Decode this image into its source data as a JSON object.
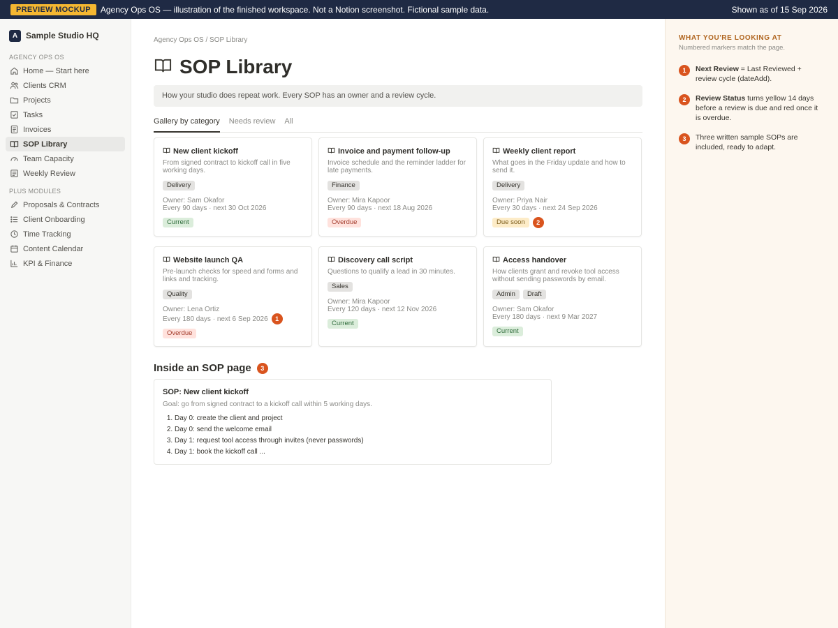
{
  "banner": {
    "badge": "PREVIEW MOCKUP",
    "message": "Agency Ops OS — illustration of the finished workspace. Not a Notion screenshot. Fictional sample data.",
    "as_of": "Shown as of 15 Sep 2026"
  },
  "workspace": {
    "logo_letter": "A",
    "name": "Sample Studio HQ"
  },
  "sidebar": {
    "section1": "AGENCY OPS OS",
    "items": [
      {
        "label": "Home — Start here",
        "icon": "home-icon"
      },
      {
        "label": "Clients CRM",
        "icon": "users-icon"
      },
      {
        "label": "Projects",
        "icon": "folder-icon"
      },
      {
        "label": "Tasks",
        "icon": "checkbox-icon"
      },
      {
        "label": "Invoices",
        "icon": "invoice-icon"
      },
      {
        "label": "SOP Library",
        "icon": "book-icon",
        "active": true
      },
      {
        "label": "Team Capacity",
        "icon": "gauge-icon"
      },
      {
        "label": "Weekly Review",
        "icon": "review-icon"
      }
    ],
    "section2": "PLUS MODULES",
    "items2": [
      {
        "label": "Proposals & Contracts",
        "icon": "pen-icon"
      },
      {
        "label": "Client Onboarding",
        "icon": "list-icon"
      },
      {
        "label": "Time Tracking",
        "icon": "clock-icon"
      },
      {
        "label": "Content Calendar",
        "icon": "calendar-icon"
      },
      {
        "label": "KPI & Finance",
        "icon": "chart-icon"
      }
    ]
  },
  "main": {
    "breadcrumb": "Agency Ops OS / SOP Library",
    "title": "SOP Library",
    "callout": "How your studio does repeat work. Every SOP has an owner and a review cycle.",
    "tabs": [
      "Gallery by category",
      "Needs review",
      "All"
    ],
    "cards": [
      {
        "title": "New client kickoff",
        "desc": "From signed contract to kickoff call in five working days.",
        "tags": [
          "Delivery"
        ],
        "owner": "Owner: Sam Okafor",
        "cycle": "Every 90 days · next 30 Oct 2026",
        "status": "Current"
      },
      {
        "title": "Invoice and payment follow-up",
        "desc": "Invoice schedule and the reminder ladder for late payments.",
        "tags": [
          "Finance"
        ],
        "owner": "Owner: Mira Kapoor",
        "cycle": "Every 90 days · next 18 Aug 2026",
        "status": "Overdue"
      },
      {
        "title": "Weekly client report",
        "desc": "What goes in the Friday update and how to send it.",
        "tags": [
          "Delivery"
        ],
        "owner": "Owner: Priya Nair",
        "cycle": "Every 30 days · next 24 Sep 2026",
        "status": "Due soon",
        "marker": "2"
      },
      {
        "title": "Website launch QA",
        "desc": "Pre-launch checks for speed and forms and links and tracking.",
        "tags": [
          "Quality"
        ],
        "owner": "Owner: Lena Ortiz",
        "cycle": "Every 180 days · next 6 Sep 2026",
        "status": "Overdue",
        "cycle_marker": "1"
      },
      {
        "title": "Discovery call script",
        "desc": "Questions to qualify a lead in 30 minutes.",
        "tags": [
          "Sales"
        ],
        "owner": "Owner: Mira Kapoor",
        "cycle": "Every 120 days · next 12 Nov 2026",
        "status": "Current"
      },
      {
        "title": "Access handover",
        "desc": "How clients grant and revoke tool access without sending passwords by email.",
        "tags": [
          "Admin",
          "Draft"
        ],
        "owner": "Owner: Sam Okafor",
        "cycle": "Every 180 days · next 9 Mar 2027",
        "status": "Current"
      }
    ],
    "section_title": "Inside an SOP page",
    "section_marker": "3",
    "sop": {
      "title": "SOP: New client kickoff",
      "goal": "Goal: go from signed contract to a kickoff call within 5 working days.",
      "steps": [
        "Day 0: create the client and project",
        "Day 0: send the welcome email",
        "Day 1: request tool access through invites (never passwords)",
        "Day 1: book the kickoff call ..."
      ]
    }
  },
  "guide": {
    "heading": "WHAT YOU'RE LOOKING AT",
    "subheading": "Numbered markers match the page.",
    "items": [
      {
        "num": "1",
        "bold": "Next Review",
        "text": " = Last Reviewed + review cycle (dateAdd)."
      },
      {
        "num": "2",
        "bold": "Review Status",
        "text": " turns yellow 14 days before a review is due and red once it is overdue."
      },
      {
        "num": "3",
        "bold": "",
        "text": "Three written sample SOPs are included, ready to adapt."
      }
    ]
  },
  "colors": {
    "banner_bg": "#1f2a44",
    "badge_bg": "#f5b731",
    "marker": "#d9541e",
    "guide_heading": "#b0651f",
    "status_current_bg": "#dbeddb",
    "status_overdue_bg": "#ffe2dd",
    "status_due_bg": "#fdecc8"
  }
}
